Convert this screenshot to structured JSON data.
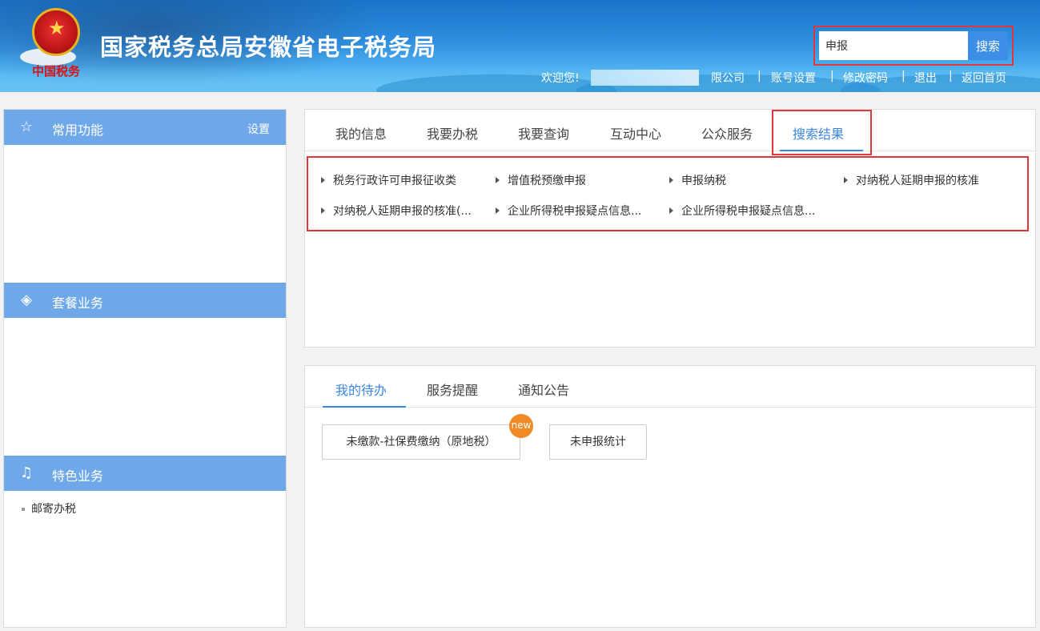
{
  "header": {
    "site_title": "国家税务总局安徽省电子税务局",
    "emblem_text": "中国税务",
    "welcome": "欢迎您!",
    "welcome_suffix": "限公司",
    "links": [
      "账号设置",
      "修改密码",
      "退出",
      "返回首页"
    ],
    "separator": "|",
    "search": {
      "value": "申报",
      "button": "搜索"
    }
  },
  "sidebar": {
    "sections": [
      {
        "icon": "star-outline-icon",
        "label": "常用功能",
        "action": "设置"
      },
      {
        "icon": "layers-icon",
        "label": "套餐业务"
      },
      {
        "icon": "bell-icon",
        "label": "特色业务",
        "items": [
          "邮寄办税"
        ]
      }
    ]
  },
  "top_panel": {
    "tabs": [
      "我的信息",
      "我要办税",
      "我要查询",
      "互动中心",
      "公众服务",
      "搜索结果"
    ],
    "active_tab": "搜索结果",
    "results": [
      "税务行政许可申报征收类",
      "增值税预缴申报",
      "申报纳税",
      "对纳税人延期申报的核准",
      "对纳税人延期申报的核准(...",
      "企业所得税申报疑点信息...",
      "企业所得税申报疑点信息..."
    ]
  },
  "bottom_panel": {
    "tabs": [
      "我的待办",
      "服务提醒",
      "通知公告"
    ],
    "active_tab": "我的待办",
    "buttons": [
      "未缴款-社保费缴纳（原地税）",
      "未申报统计"
    ],
    "badge": "new"
  },
  "colors": {
    "accent": "#3b86e0",
    "highlight": "#e0383a",
    "sidebar_head": "#6fa8e8",
    "badge": "#f08a24"
  }
}
